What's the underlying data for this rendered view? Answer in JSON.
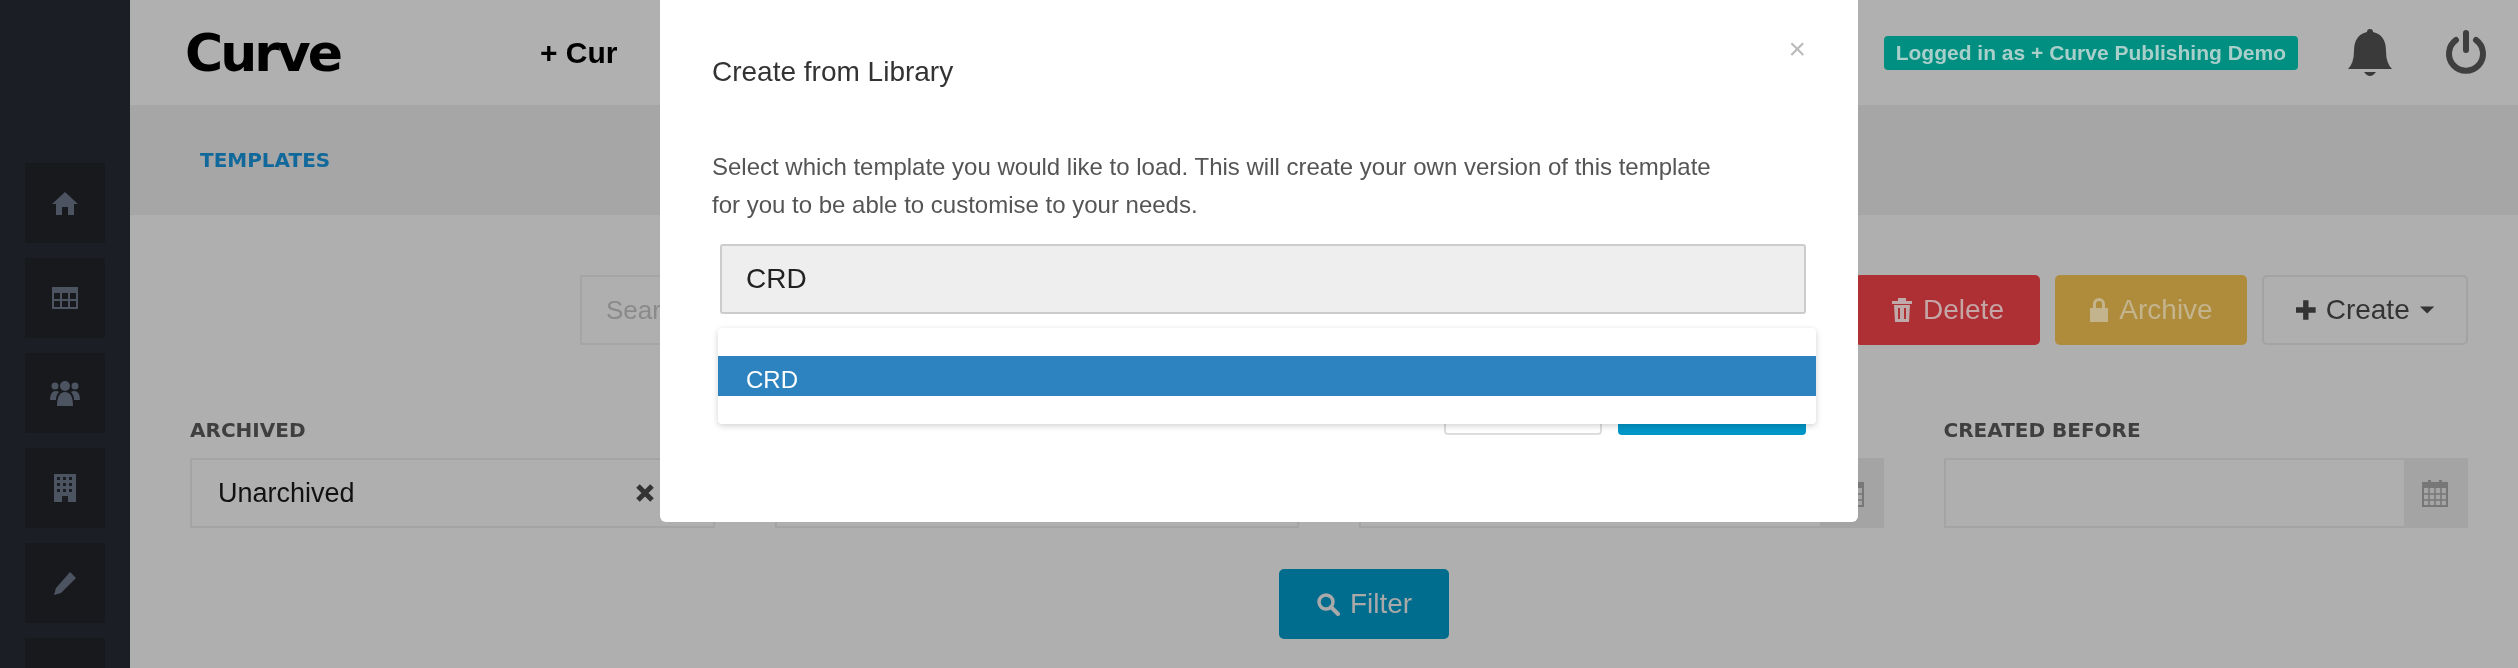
{
  "header": {
    "logo": "Curve",
    "nav_link": "+ Cur",
    "user_badge": "Logged in as + Curve Publishing Demo"
  },
  "subnav": {
    "tabs": [
      {
        "label": "TEMPLATES",
        "selected": true
      }
    ]
  },
  "toolbar": {
    "search": {
      "placeholder": "Sear"
    },
    "buttons": [
      {
        "label": "Delete",
        "kind": "delete"
      },
      {
        "label": "Archive",
        "kind": "archive"
      },
      {
        "label": "Create",
        "kind": "create"
      }
    ]
  },
  "filters": [
    {
      "label": "ARCHIVED",
      "value": "Unarchived",
      "kind": "select"
    },
    {
      "kind": "text"
    },
    {
      "kind": "date"
    },
    {
      "label": "CREATED BEFORE",
      "kind": "date"
    }
  ],
  "filter_button": "Filter",
  "modal": {
    "title": "Create from Library",
    "close": "×",
    "text": "Select which template you would like to load. This will create your own version of this template for you to be able to customise to your needs.",
    "field": {
      "value": "CRD"
    },
    "options": [
      {
        "label": "CRD",
        "selected": true
      }
    ]
  }
}
